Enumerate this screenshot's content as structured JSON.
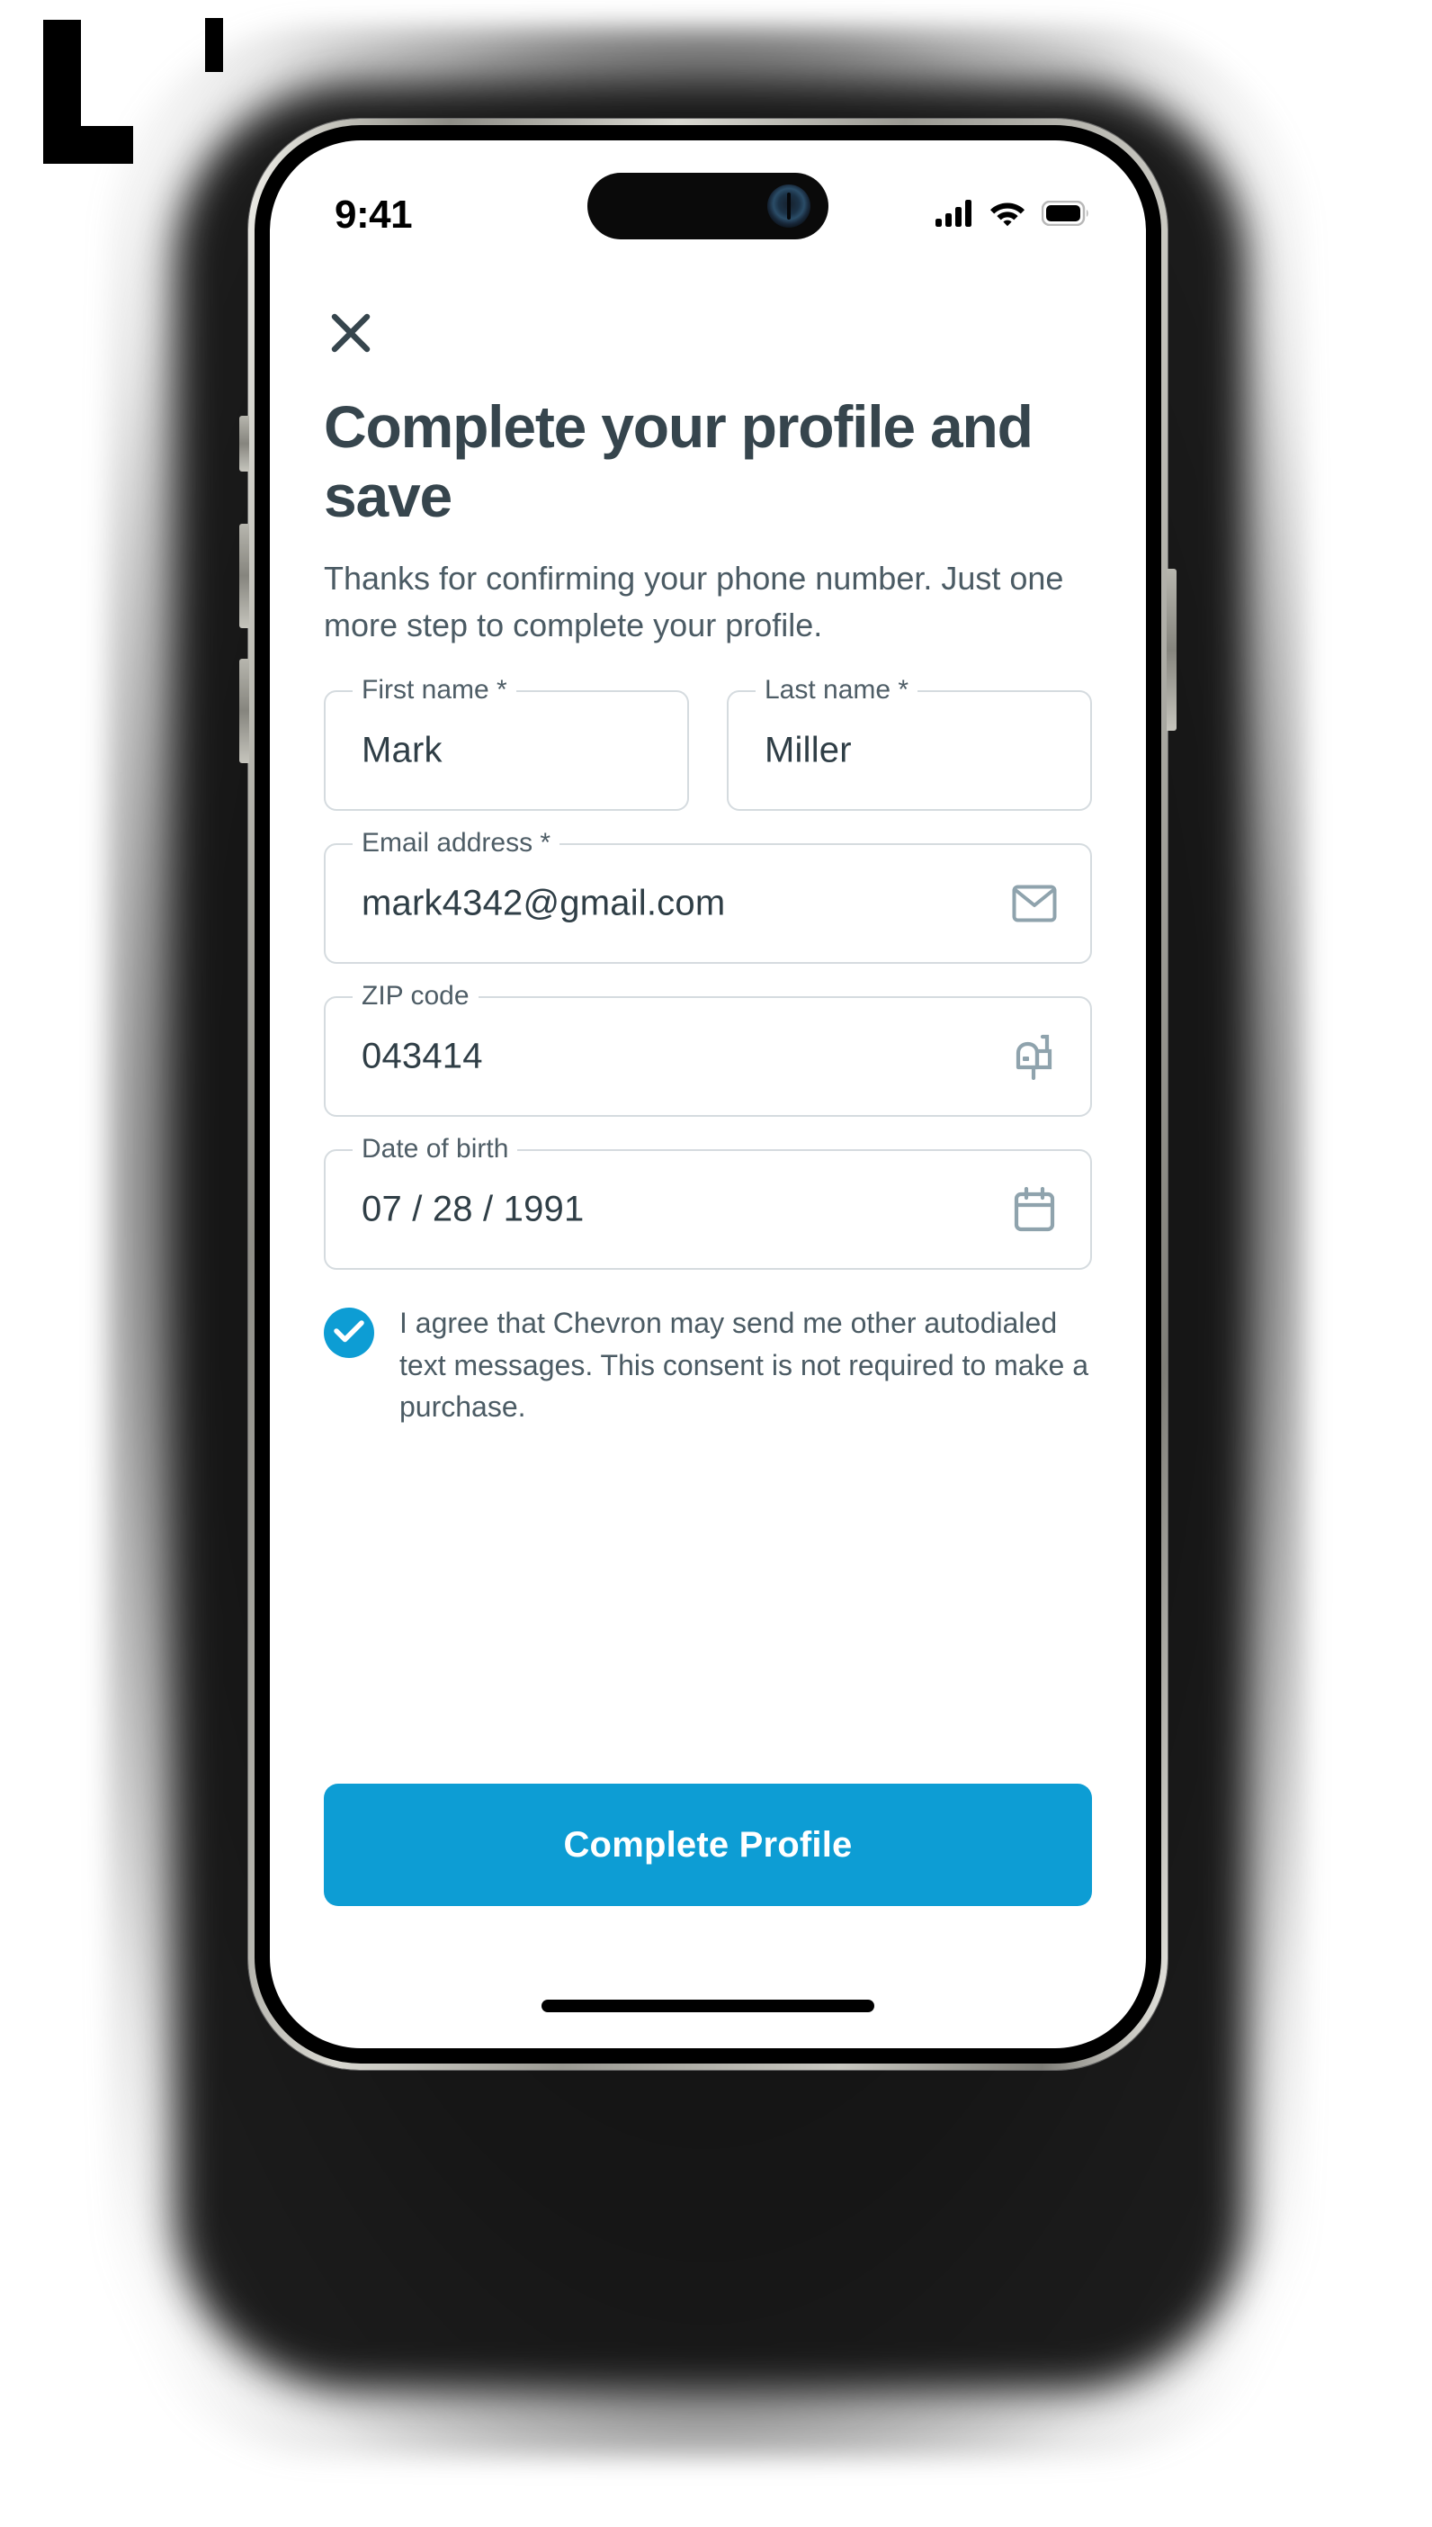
{
  "status_bar": {
    "time": "9:41",
    "cellular_icon": "cellular-signal-icon",
    "wifi_icon": "wifi-icon",
    "battery_icon": "battery-full-icon"
  },
  "header": {
    "close_icon": "close-x-icon",
    "title": "Complete your profile and save",
    "subtitle": "Thanks for confirming your phone number. Just one more step to complete your profile."
  },
  "form": {
    "fields": [
      {
        "label": "First name *",
        "value": "Mark",
        "icon": ""
      },
      {
        "label": "Last name *",
        "value": "Miller",
        "icon": ""
      },
      {
        "label": "Email address *",
        "value": "mark4342@gmail.com",
        "icon": "envelope-icon"
      },
      {
        "label": "ZIP code",
        "value": "043414",
        "icon": "mailbox-icon"
      },
      {
        "label": "Date of birth",
        "value": "07 / 28 / 1991",
        "icon": "calendar-icon"
      }
    ]
  },
  "consent": {
    "checked": true,
    "check_icon": "checkmark-icon",
    "text": "I agree that Chevron may send me other autodialed text messages. This consent is not required to make a purchase."
  },
  "cta": {
    "label": "Complete Profile"
  },
  "colors": {
    "accent": "#0d9dd4",
    "heading": "#36454d",
    "body_text": "#4b5b64",
    "field_border": "#d5dbdf",
    "icon": "#8fa3ad"
  }
}
